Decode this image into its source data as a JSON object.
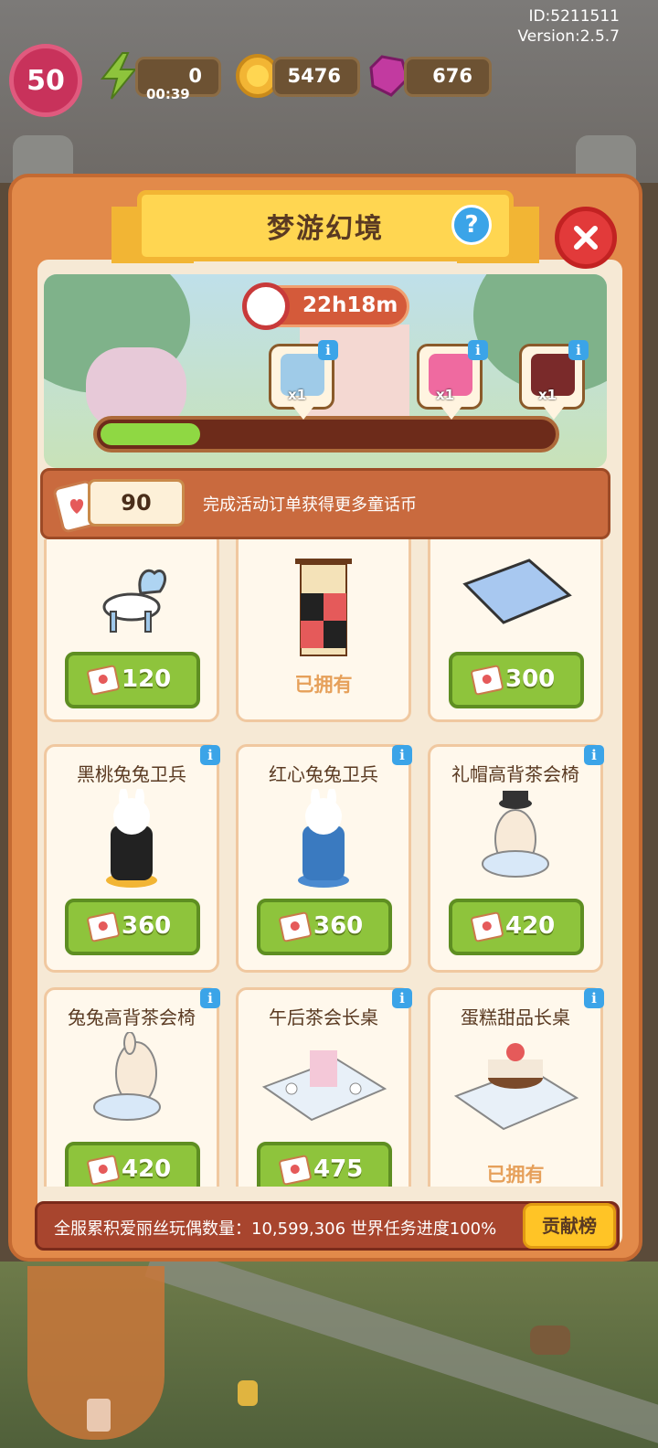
{
  "hud": {
    "user_id": "ID:5211511",
    "version": "Version:2.5.7",
    "level": "50",
    "energy": "0",
    "energy_timer": "00:39",
    "coins": "5476",
    "gems": "676"
  },
  "event": {
    "title": "梦游幻境",
    "timer": "22h18m",
    "progress_fraction": 0.22,
    "rewards": [
      {
        "count": "x1",
        "icon": "gift-box-icon",
        "color": "#9fcbe8"
      },
      {
        "count": "x1",
        "icon": "pink-backpack-icon",
        "color": "#ef6aa0"
      },
      {
        "count": "x1",
        "icon": "heart-hat-icon",
        "color": "#7a2a2a"
      }
    ],
    "currency_amount": "90",
    "currency_hint": "完成活动订单获得更多童话币"
  },
  "shop": {
    "items": [
      {
        "name": "",
        "price": "120",
        "owned": "",
        "icon": "heart-chair-icon"
      },
      {
        "name": "",
        "price": "",
        "owned": "已拥有",
        "icon": "card-banner-icon"
      },
      {
        "name": "",
        "price": "300",
        "owned": "",
        "icon": "checkered-rug-icon"
      },
      {
        "name": "黑桃兔兔卫兵",
        "price": "360",
        "owned": "",
        "icon": "spade-rabbit-guard-icon"
      },
      {
        "name": "红心兔兔卫兵",
        "price": "360",
        "owned": "",
        "icon": "heart-rabbit-guard-icon"
      },
      {
        "name": "礼帽高背茶会椅",
        "price": "420",
        "owned": "",
        "icon": "tophat-tea-chair-icon"
      },
      {
        "name": "兔兔高背茶会椅",
        "price": "420",
        "owned": "",
        "icon": "rabbit-tea-chair-icon"
      },
      {
        "name": "午后茶会长桌",
        "price": "475",
        "owned": "",
        "icon": "afternoon-tea-table-icon"
      },
      {
        "name": "蛋糕甜品长桌",
        "price": "",
        "owned": "已拥有",
        "icon": "cake-dessert-table-icon"
      }
    ]
  },
  "footer": {
    "stats": "全服累积爱丽丝玩偶数量：10,599,306  世界任务进度100%",
    "rank_button": "贡献榜"
  },
  "colors": {
    "panel": "#e28a4a",
    "buy_button": "#8ec43c",
    "title_plate": "#ffd651",
    "close": "#e23a3a"
  }
}
